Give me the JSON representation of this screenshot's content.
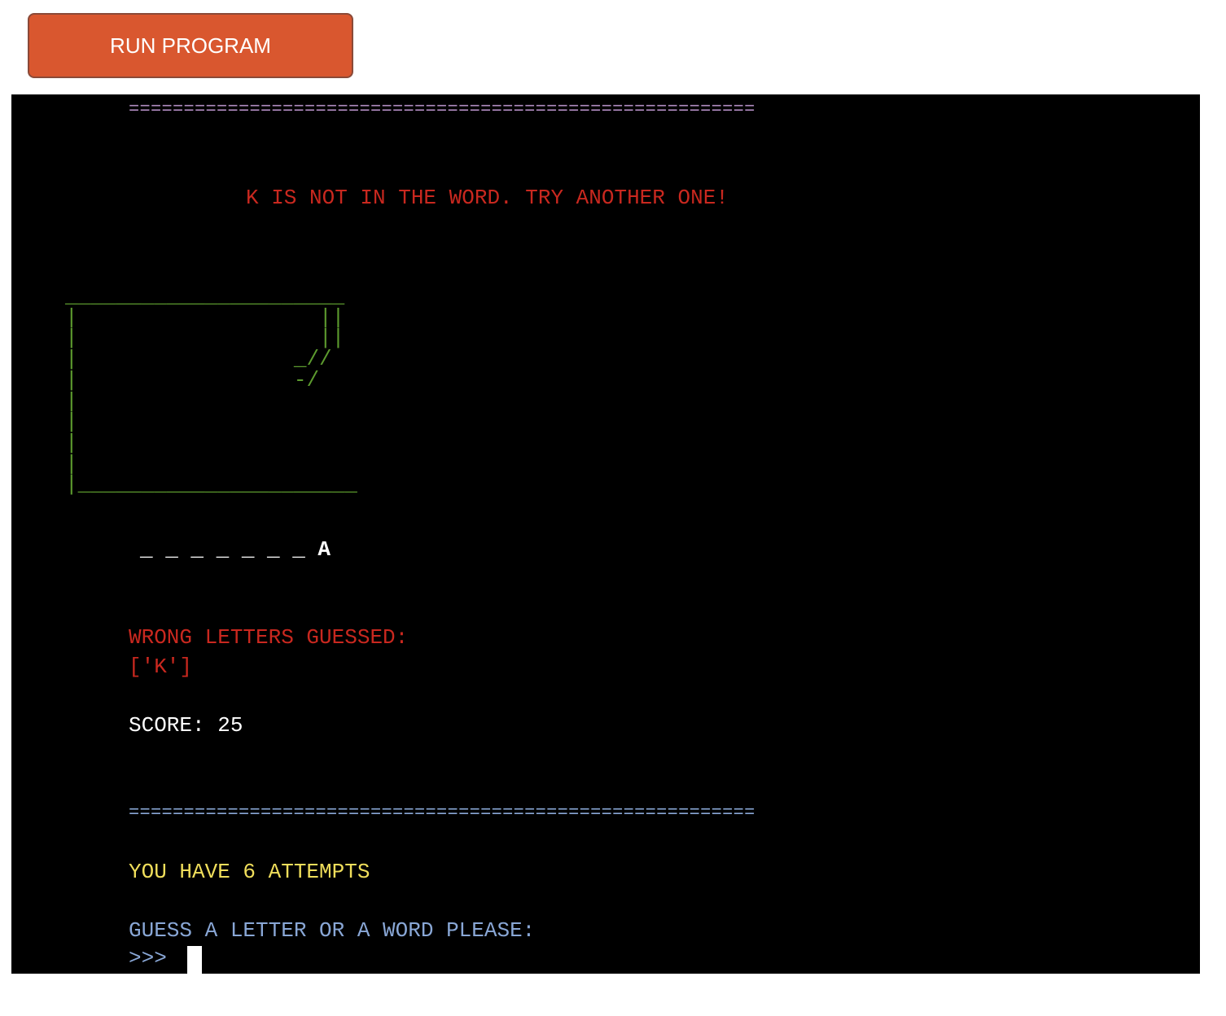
{
  "toolbar": {
    "run_label": "RUN PROGRAM",
    "accent_color": "#d9572f"
  },
  "terminal": {
    "top_separator": "=========================================================",
    "message": "K IS NOT IN THE WORD. TRY ANOTHER ONE!",
    "hangman_art": "______________________\n|                   ||\n|                   ||\n|                 _//\n|                 -/\n|\n|\n|\n|\n|______________________",
    "word_progress": "_ _ _ _ _ _ _ A",
    "wrong_letters_label": "WRONG LETTERS GUESSED:",
    "wrong_letters_value": "['K']",
    "score_text": "SCORE: 25",
    "bottom_separator": "=========================================================",
    "attempts_text": "YOU HAVE 6 ATTEMPTS",
    "prompt_text": "GUESS A LETTER OR A WORD PLEASE:",
    "input_prompt": ">>>"
  },
  "colors": {
    "error": "#c9281f",
    "art": "#5c9a2e",
    "attempts": "#f0de5b",
    "prompt": "#89a7d6",
    "top_separator": "#b08bc0",
    "background": "#000000"
  }
}
